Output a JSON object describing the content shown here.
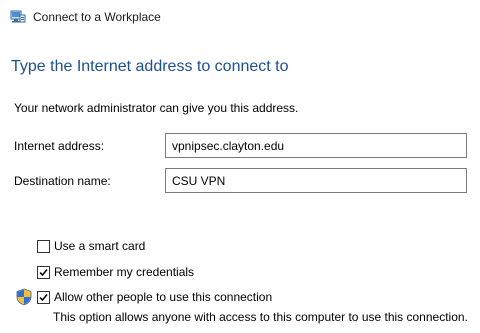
{
  "window": {
    "title": "Connect to a Workplace",
    "icon": "network-workplace-icon"
  },
  "page": {
    "heading": "Type the Internet address to connect to",
    "instructions": "Your network administrator can give you this address."
  },
  "form": {
    "internet_address": {
      "label": "Internet address:",
      "value": "vpnipsec.clayton.edu"
    },
    "destination_name": {
      "label": "Destination name:",
      "value": "CSU VPN"
    }
  },
  "options": {
    "smart_card": {
      "label": "Use a smart card",
      "checked": false
    },
    "remember_credentials": {
      "label": "Remember my credentials",
      "checked": true
    },
    "allow_others": {
      "label": "Allow other people to use this connection",
      "checked": true,
      "note": "This option allows anyone with access to this computer to use this connection.",
      "icon": "uac-shield-icon"
    }
  },
  "colors": {
    "heading": "#1d4f91",
    "input_border": "#7a7a7a"
  }
}
